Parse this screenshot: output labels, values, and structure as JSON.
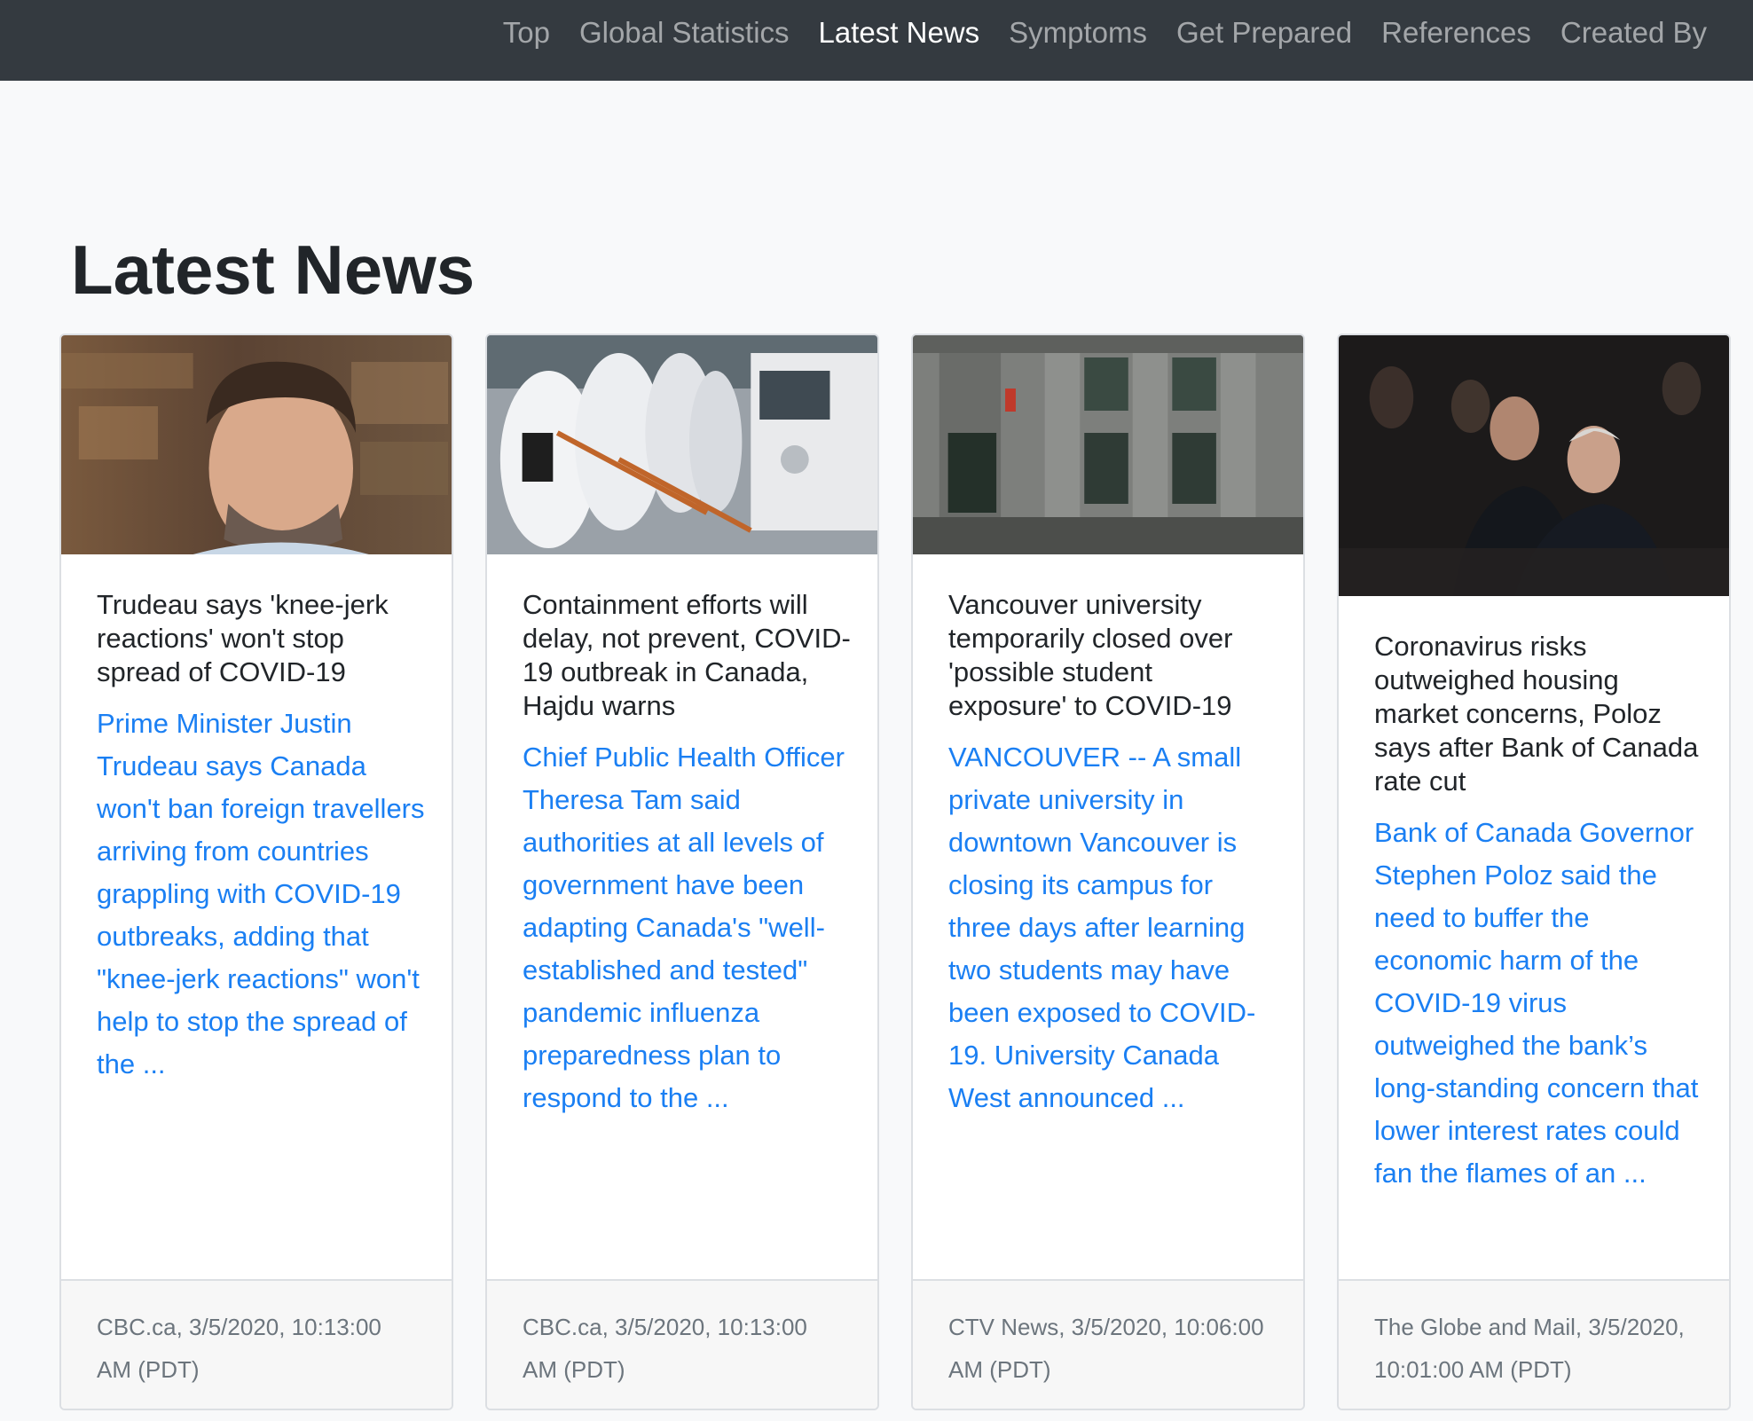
{
  "nav": {
    "items": [
      {
        "label": "Top",
        "active": false
      },
      {
        "label": "Global Statistics",
        "active": false
      },
      {
        "label": "Latest News",
        "active": true
      },
      {
        "label": "Symptoms",
        "active": false
      },
      {
        "label": "Get Prepared",
        "active": false
      },
      {
        "label": "References",
        "active": false
      },
      {
        "label": "Created By",
        "active": false
      }
    ]
  },
  "section": {
    "title": "Latest News"
  },
  "cards": [
    {
      "title": "Trudeau says 'knee-jerk reactions' won't stop spread of COVID-19",
      "summary": "Prime Minister Justin Trudeau says Canada won't ban foreign travellers arriving from countries grappling with COVID-19 outbreaks, adding that \"knee-jerk reactions\" won't help to stop the spread of the ...",
      "footer": "CBC.ca, 3/5/2020, 10:13:00 AM (PDT)"
    },
    {
      "title": "Containment efforts will delay, not prevent, COVID-19 outbreak in Canada, Hajdu warns",
      "summary": "Chief Public Health Officer Theresa Tam said authorities at all levels of government have been adapting Canada's \"well-established and tested\" pandemic influenza preparedness plan to respond to the ...",
      "footer": "CBC.ca, 3/5/2020, 10:13:00 AM (PDT)"
    },
    {
      "title": "Vancouver university temporarily closed over 'possible student exposure' to COVID-19",
      "summary": "VANCOUVER -- A small private university in downtown Vancouver is closing its campus for three days after learning two students may have been exposed to COVID-19. University Canada West announced ...",
      "footer": "CTV News, 3/5/2020, 10:06:00 AM (PDT)"
    },
    {
      "title": "Coronavirus risks outweighed housing market concerns, Poloz says after Bank of Canada rate cut",
      "summary": "Bank of Canada Governor Stephen Poloz said the need to buffer the economic harm of the COVID-19 virus outweighed the bank’s long-standing concern that lower interest rates could fan the flames of an ...",
      "footer": "The Globe and Mail, 3/5/2020, 10:01:00 AM (PDT)"
    }
  ]
}
